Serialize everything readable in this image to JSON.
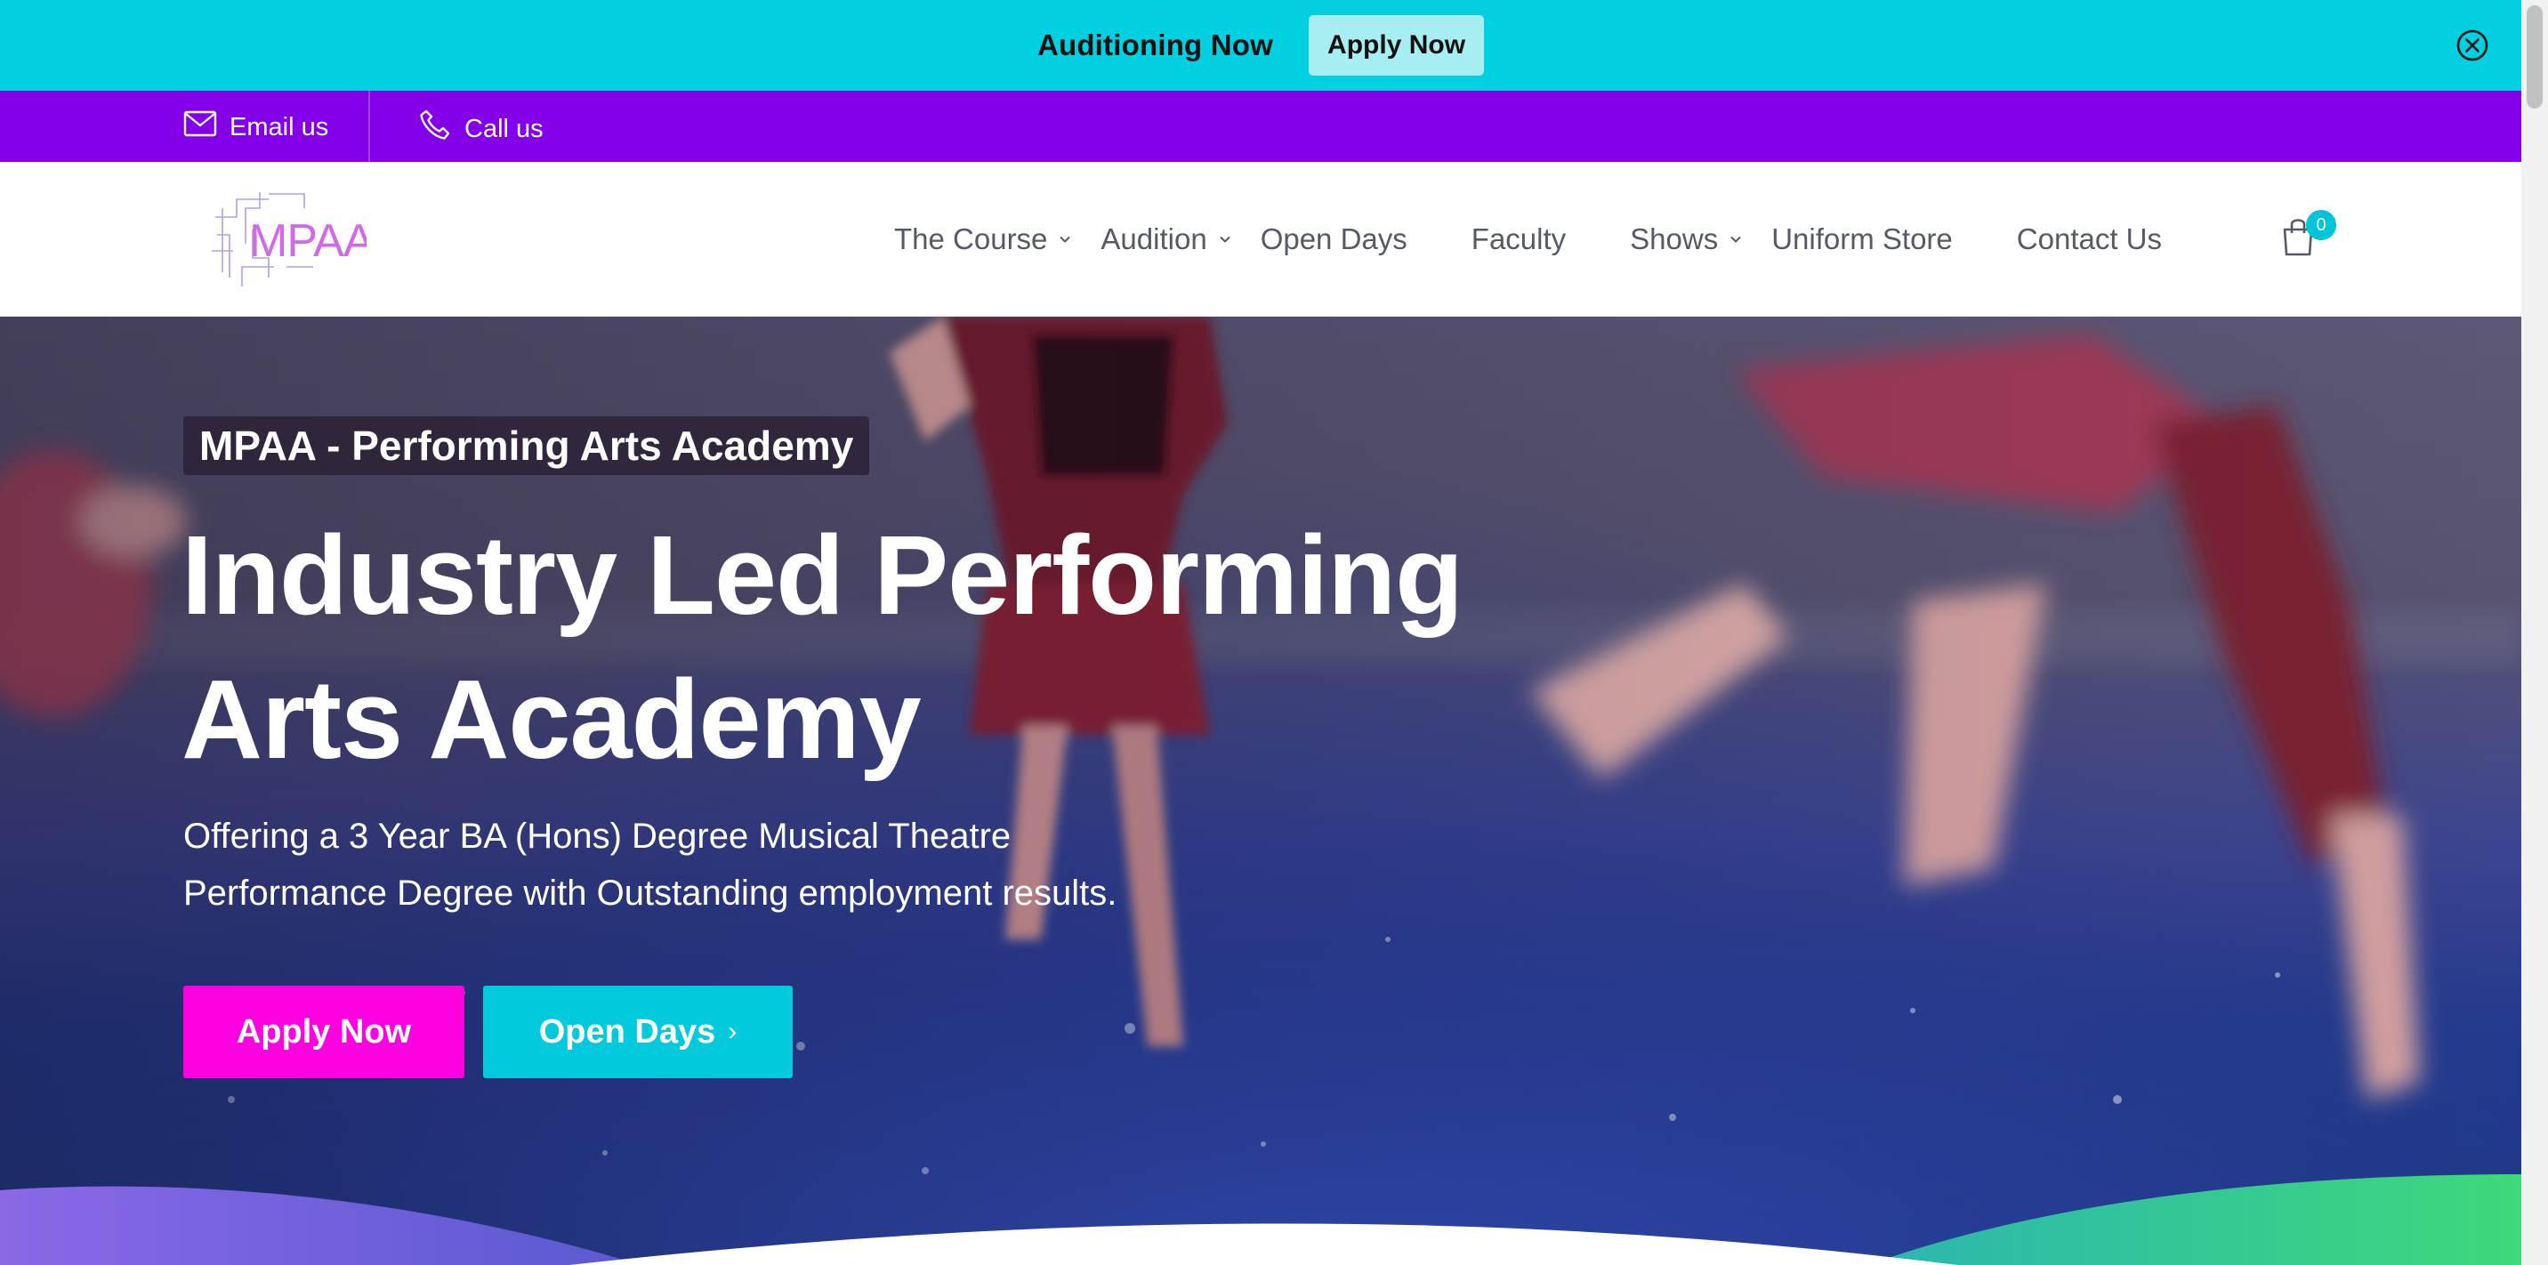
{
  "announcement": {
    "text": "Auditioning Now",
    "button_label": "Apply Now",
    "close_icon": "close-circle-icon"
  },
  "contact_bar": {
    "email_label": "Email us",
    "email_icon": "envelope-icon",
    "call_label": "Call us",
    "call_icon": "phone-icon"
  },
  "header": {
    "logo_text": "MPAA",
    "nav": [
      {
        "label": "The Course",
        "has_dropdown": true
      },
      {
        "label": "Audition",
        "has_dropdown": true
      },
      {
        "label": "Open Days",
        "has_dropdown": false
      },
      {
        "label": "Faculty",
        "has_dropdown": false
      },
      {
        "label": "Shows",
        "has_dropdown": true
      },
      {
        "label": "Uniform Store",
        "has_dropdown": false
      },
      {
        "label": "Contact Us",
        "has_dropdown": false
      }
    ],
    "cart_icon": "shopping-bag-icon",
    "cart_count": "0"
  },
  "hero": {
    "tag": "MPAA - Performing Arts Academy",
    "title_line1": "Industry Led Performing",
    "title_line2": "Arts Academy",
    "subtitle_line1": "Offering a 3 Year BA (Hons) Degree Musical Theatre",
    "subtitle_line2": "Performance Degree with Outstanding employment results.",
    "apply_label": "Apply Now",
    "open_days_label": "Open Days",
    "open_days_arrow": "›"
  },
  "colors": {
    "announcement_bg": "#00d0e0",
    "contact_bg": "#8400e8",
    "apply_button": "#ff00e0",
    "open_days_button": "#00cadb",
    "nav_text": "#555a66"
  }
}
